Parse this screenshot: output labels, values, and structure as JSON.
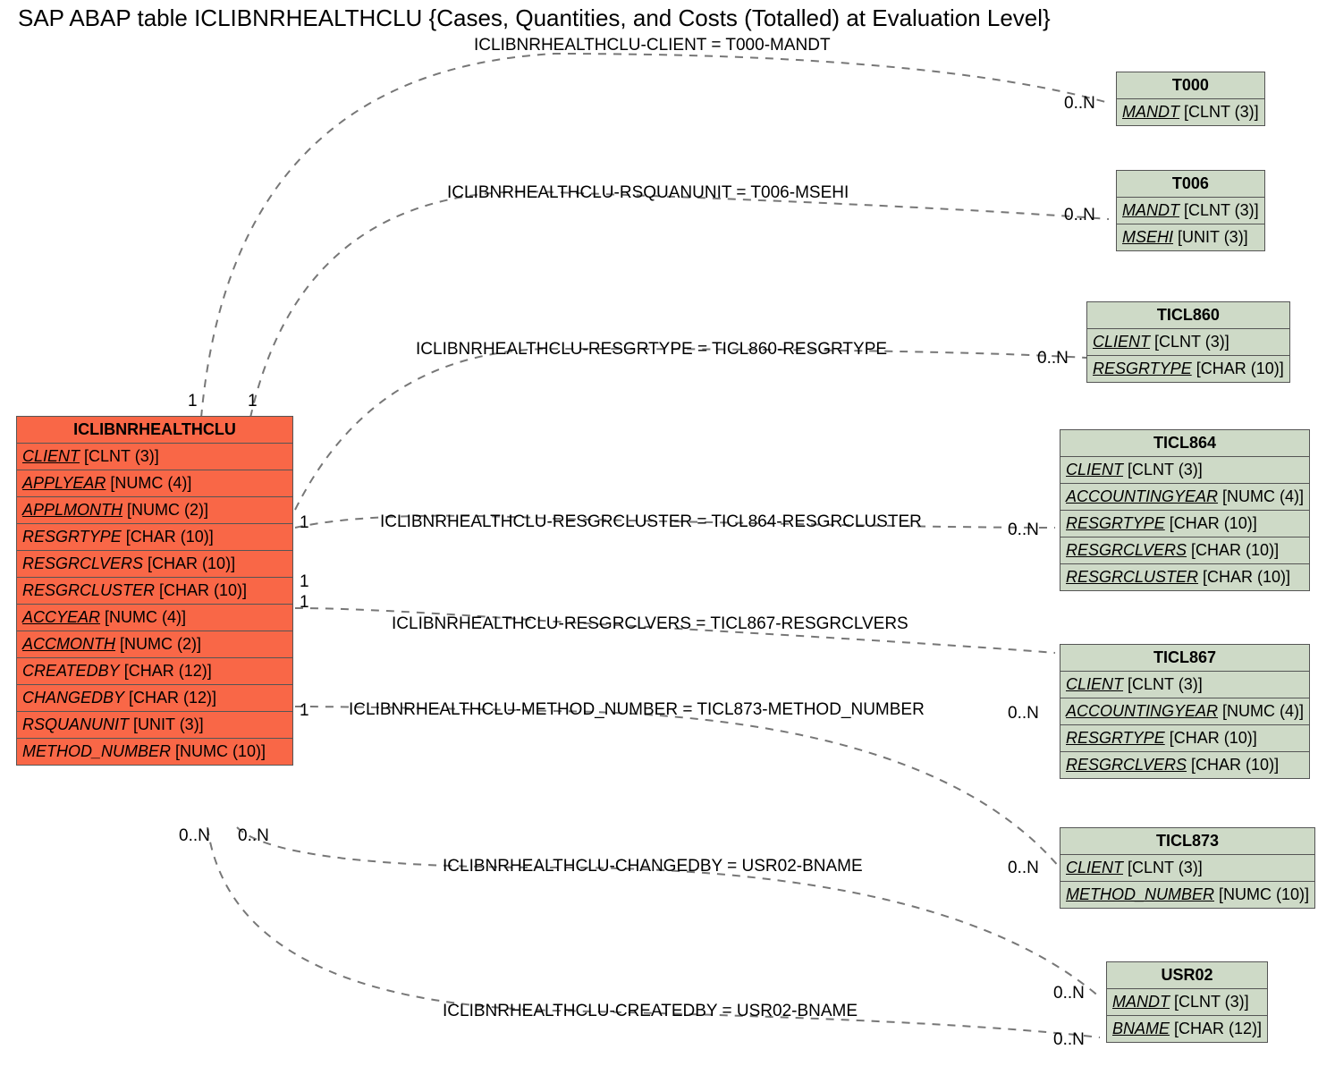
{
  "title": "SAP ABAP table ICLIBNRHEALTHCLU {Cases, Quantities, and Costs (Totalled) at Evaluation Level}",
  "relations": {
    "r0": "ICLIBNRHEALTHCLU-CLIENT = T000-MANDT",
    "r1": "ICLIBNRHEALTHCLU-RSQUANUNIT = T006-MSEHI",
    "r2": "ICLIBNRHEALTHCLU-RESGRTYPE = TICL860-RESGRTYPE",
    "r3": "ICLIBNRHEALTHCLU-RESGRCLUSTER = TICL864-RESGRCLUSTER",
    "r4": "ICLIBNRHEALTHCLU-RESGRCLVERS = TICL867-RESGRCLVERS",
    "r5": "ICLIBNRHEALTHCLU-METHOD_NUMBER = TICL873-METHOD_NUMBER",
    "r6": "ICLIBNRHEALTHCLU-CHANGEDBY = USR02-BNAME",
    "r7": "ICLIBNRHEALTHCLU-CREATEDBY = USR02-BNAME"
  },
  "mult": {
    "one": "1",
    "zn": "0..N"
  },
  "main": {
    "name": "ICLIBNRHEALTHCLU",
    "rows": [
      {
        "f": "CLIENT",
        "t": " [CLNT (3)]",
        "ul": true
      },
      {
        "f": "APPLYEAR",
        "t": " [NUMC (4)]",
        "ul": true
      },
      {
        "f": "APPLMONTH",
        "t": " [NUMC (2)]",
        "ul": true
      },
      {
        "f": "RESGRTYPE",
        "t": " [CHAR (10)]",
        "ul": false,
        "fi": true
      },
      {
        "f": "RESGRCLVERS",
        "t": " [CHAR (10)]",
        "ul": false,
        "fi": true
      },
      {
        "f": "RESGRCLUSTER",
        "t": " [CHAR (10)]",
        "ul": false,
        "fi": true
      },
      {
        "f": "ACCYEAR",
        "t": " [NUMC (4)]",
        "ul": true
      },
      {
        "f": "ACCMONTH",
        "t": " [NUMC (2)]",
        "ul": true
      },
      {
        "f": "CREATEDBY",
        "t": " [CHAR (12)]",
        "ul": false,
        "fi": true
      },
      {
        "f": "CHANGEDBY",
        "t": " [CHAR (12)]",
        "ul": false,
        "fi": true
      },
      {
        "f": "RSQUANUNIT",
        "t": " [UNIT (3)]",
        "ul": false,
        "fi": true
      },
      {
        "f": "METHOD_NUMBER",
        "t": " [NUMC (10)]",
        "ul": false,
        "fi": true
      }
    ]
  },
  "refs": {
    "t000": {
      "name": "T000",
      "rows": [
        {
          "f": "MANDT",
          "t": " [CLNT (3)]",
          "ul": true
        }
      ]
    },
    "t006": {
      "name": "T006",
      "rows": [
        {
          "f": "MANDT",
          "t": " [CLNT (3)]",
          "ul": true,
          "fi": true
        },
        {
          "f": "MSEHI",
          "t": " [UNIT (3)]",
          "ul": true
        }
      ]
    },
    "t860": {
      "name": "TICL860",
      "rows": [
        {
          "f": "CLIENT",
          "t": " [CLNT (3)]",
          "ul": true,
          "fi": true
        },
        {
          "f": "RESGRTYPE",
          "t": " [CHAR (10)]",
          "ul": true
        }
      ]
    },
    "t864": {
      "name": "TICL864",
      "rows": [
        {
          "f": "CLIENT",
          "t": " [CLNT (3)]",
          "ul": true,
          "fi": true
        },
        {
          "f": "ACCOUNTINGYEAR",
          "t": " [NUMC (4)]",
          "ul": true
        },
        {
          "f": "RESGRTYPE",
          "t": " [CHAR (10)]",
          "ul": true,
          "fi": true
        },
        {
          "f": "RESGRCLVERS",
          "t": " [CHAR (10)]",
          "ul": true,
          "fi": true
        },
        {
          "f": "RESGRCLUSTER",
          "t": " [CHAR (10)]",
          "ul": true,
          "fi": true
        }
      ]
    },
    "t867": {
      "name": "TICL867",
      "rows": [
        {
          "f": "CLIENT",
          "t": " [CLNT (3)]",
          "ul": true,
          "fi": true
        },
        {
          "f": "ACCOUNTINGYEAR",
          "t": " [NUMC (4)]",
          "ul": true
        },
        {
          "f": "RESGRTYPE",
          "t": " [CHAR (10)]",
          "ul": true,
          "fi": true
        },
        {
          "f": "RESGRCLVERS",
          "t": " [CHAR (10)]",
          "ul": true,
          "fi": true
        }
      ]
    },
    "t873": {
      "name": "TICL873",
      "rows": [
        {
          "f": "CLIENT",
          "t": " [CLNT (3)]",
          "ul": true,
          "fi": true
        },
        {
          "f": "METHOD_NUMBER",
          "t": " [NUMC (10)]",
          "ul": true
        }
      ]
    },
    "usr02": {
      "name": "USR02",
      "rows": [
        {
          "f": "MANDT",
          "t": " [CLNT (3)]",
          "ul": true,
          "fi": true
        },
        {
          "f": "BNAME",
          "t": " [CHAR (12)]",
          "ul": true
        }
      ]
    }
  }
}
